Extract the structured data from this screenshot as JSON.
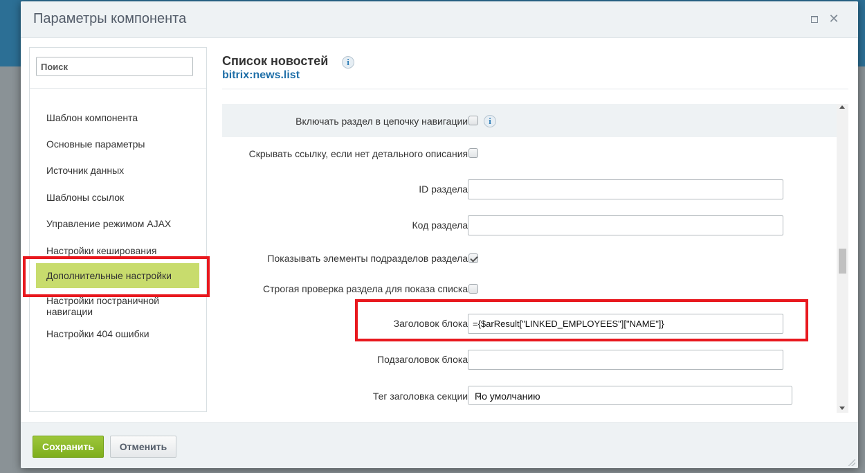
{
  "dialog": {
    "title": "Параметры компонента",
    "maximize_icon": "maximize-icon",
    "close_icon": "close-icon"
  },
  "sidebar": {
    "search_placeholder": "Поиск",
    "items": [
      {
        "label": "Шаблон компонента"
      },
      {
        "label": "Основные параметры"
      },
      {
        "label": "Источник данных"
      },
      {
        "label": "Шаблоны ссылок"
      },
      {
        "label": "Управление режимом AJAX"
      },
      {
        "label": "Настройки кеширования"
      },
      {
        "label": "Дополнительные настройки",
        "active": true
      },
      {
        "label": "Настройки постраничной навигации"
      },
      {
        "label": "Настройки 404 ошибки"
      }
    ]
  },
  "main": {
    "component_title": "Список новостей",
    "component_code": "bitrix:news.list",
    "info_icon": "info-icon",
    "rows": [
      {
        "label": "Включать раздел в цепочку навигации:",
        "type": "checkbox",
        "checked": false,
        "has_info": true
      },
      {
        "label": "Скрывать ссылку, если нет детального описания:",
        "type": "checkbox",
        "checked": false
      },
      {
        "label": "ID раздела:",
        "type": "text",
        "value": ""
      },
      {
        "label": "Код раздела:",
        "type": "text",
        "value": ""
      },
      {
        "label": "Показывать элементы подразделов раздела:",
        "type": "checkbox",
        "checked": true
      },
      {
        "label": "Строгая проверка раздела для показа списка:",
        "type": "checkbox",
        "checked": false
      },
      {
        "label": "Заголовок блока:",
        "type": "text",
        "value": "={$arResult[\"LINKED_EMPLOYEES\"][\"NAME\"]}"
      },
      {
        "label": "Подзаголовок блока:",
        "type": "text",
        "value": ""
      },
      {
        "label": "Тег заголовка секции:",
        "type": "select",
        "value": "По умолчанию"
      }
    ]
  },
  "footer": {
    "save_label": "Сохранить",
    "cancel_label": "Отменить"
  },
  "colors": {
    "save_button": "#8bb82a",
    "active_item": "#c8dc6d",
    "highlight": "#e8181e",
    "link": "#1f6fa8"
  }
}
